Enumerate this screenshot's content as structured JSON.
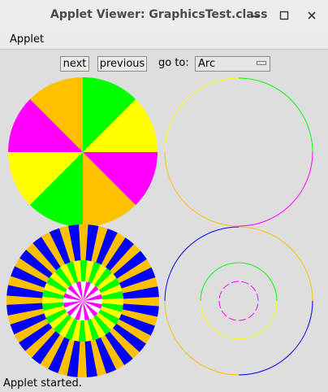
{
  "window": {
    "title": "Applet Viewer: GraphicsTest.class",
    "controls": {
      "minimize": "–",
      "maximize": "□",
      "close": "✕"
    }
  },
  "menubar": {
    "items": [
      "Applet"
    ]
  },
  "controls": {
    "next_label": "next",
    "previous_label": "previous",
    "goto_label": "go to:",
    "goto_selected": "Arc"
  },
  "colors": {
    "orange": "#ffc000",
    "green": "#00ff00",
    "yellow": "#ffff00",
    "magenta": "#ff00ff",
    "blue": "#0000ff",
    "white": "#ffffff",
    "panel_bg": "#dedede"
  },
  "status": {
    "text": "Applet started."
  }
}
